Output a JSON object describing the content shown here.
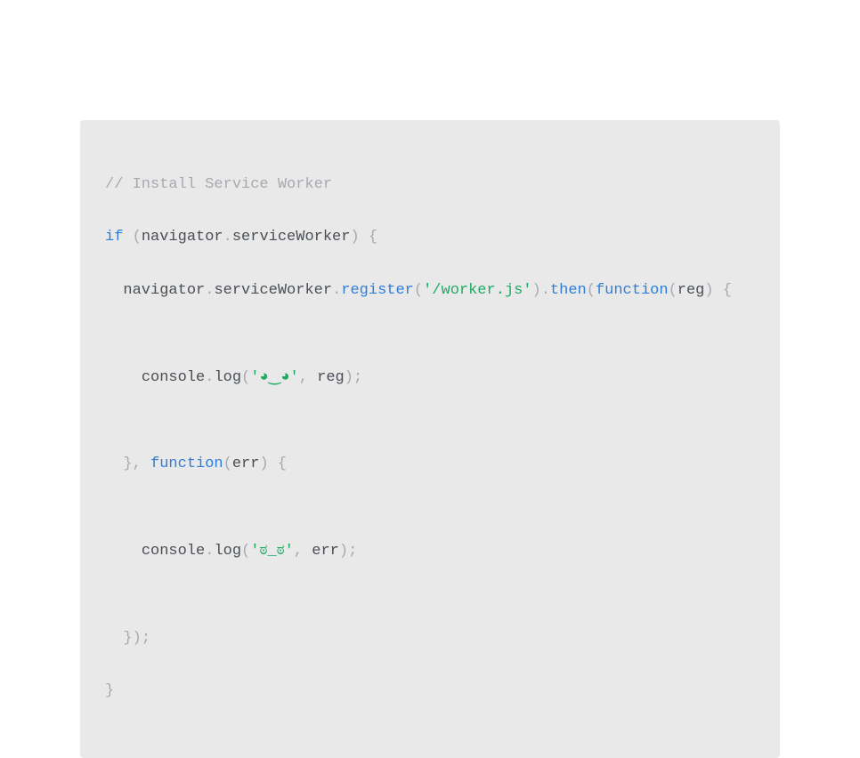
{
  "code": {
    "l1_comment": "// Install Service Worker",
    "l2": {
      "if": "if",
      "sp": " ",
      "op": "(",
      "nav": "navigator",
      "dot": ".",
      "sw": "serviceWorker",
      "cp": ")",
      "sp2": " ",
      "ob": "{"
    },
    "l3": {
      "indent": "  ",
      "nav": "navigator",
      "dot1": ".",
      "sw": "serviceWorker",
      "dot2": ".",
      "reg": "register",
      "op": "(",
      "str": "'/worker.js'",
      "cp": ")",
      "dot3": ".",
      "then": "then",
      "op2": "(",
      "fn": "function",
      "op3": "(",
      "arg": "reg",
      "cp3": ")",
      "sp": " ",
      "ob": "{"
    },
    "l4": {
      "indent": "    ",
      "console": "console",
      "dot": ".",
      "log": "log",
      "op": "(",
      "str": "'◕‿◕'",
      "comma": ",",
      "sp": " ",
      "arg": "reg",
      "cp": ")",
      "semi": ";"
    },
    "l5": {
      "indent": "  ",
      "cb": "}",
      "comma": ",",
      "sp": " ",
      "fn": "function",
      "op": "(",
      "arg": "err",
      "cp": ")",
      "sp2": " ",
      "ob": "{"
    },
    "l6": {
      "indent": "    ",
      "console": "console",
      "dot": ".",
      "log": "log",
      "op": "(",
      "str": "'ಠ_ಠ'",
      "comma": ",",
      "sp": " ",
      "arg": "err",
      "cp": ")",
      "semi": ";"
    },
    "l7": {
      "indent": "  ",
      "cb": "}",
      "cp": ")",
      "semi": ";"
    },
    "l8": {
      "cb": "}"
    }
  }
}
